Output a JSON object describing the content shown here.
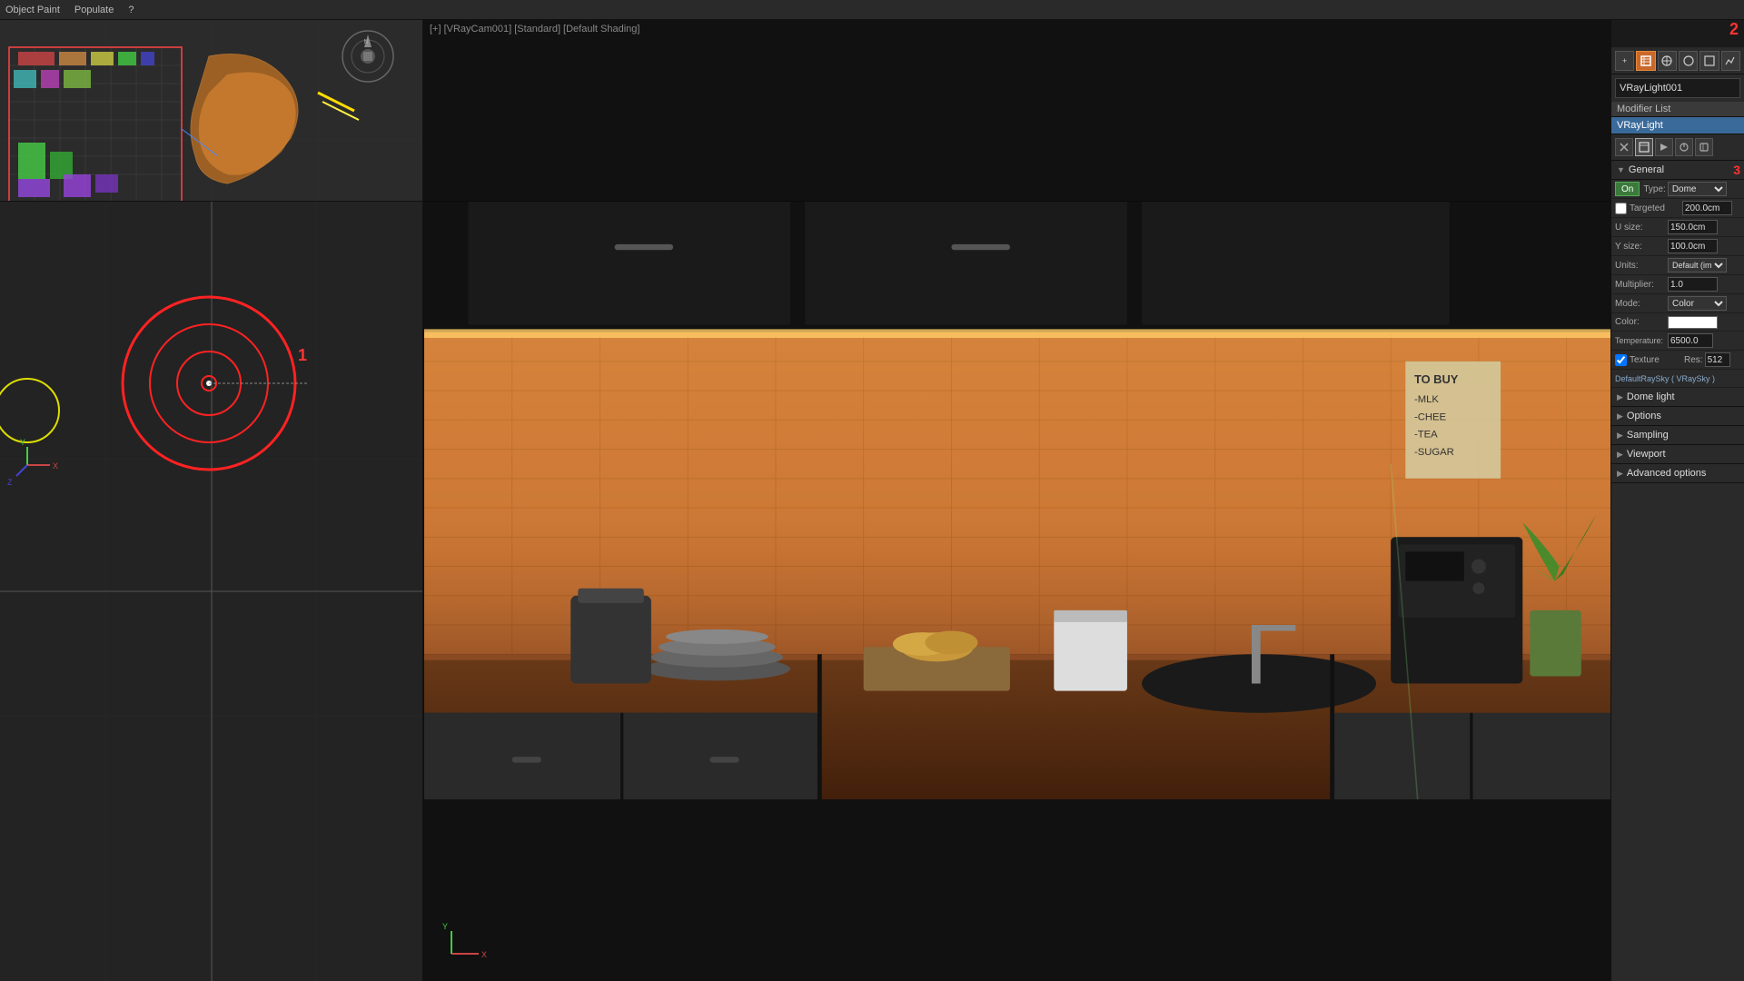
{
  "topbar": {
    "items": [
      "Object Paint",
      "Populate",
      "?"
    ]
  },
  "viewport_top_center": {
    "label": "[+] [VRayCam001] [Standard] [Default Shading]"
  },
  "right_panel": {
    "light_name": "VRayLight001",
    "modifier_list_label": "Modifier List",
    "modifier_active": "VRayLight",
    "badges": {
      "badge2": "2",
      "badge3": "3",
      "badge1": "1"
    },
    "on_button": "On",
    "type_label": "Type:",
    "type_value": "Dome",
    "targeted_label": "Targeted",
    "targeted_value": "200.0cm",
    "u_size_label": "U size:",
    "u_size_value": "150.0cm",
    "y_size_label": "Y size:",
    "y_size_value": "100.0cm",
    "units_label": "Units:",
    "units_value": "Default (image)",
    "multiplier_label": "Multiplier:",
    "multiplier_value": "1.0",
    "mode_label": "Mode:",
    "mode_value": "Color",
    "color_label": "Color:",
    "temperature_label": "Temperature:",
    "temperature_value": "6500.0",
    "texture_label": "Texture",
    "texture_res_label": "Res:",
    "texture_res_value": "512",
    "texture_name": "DefaultRaySky ( VRaySky )",
    "sections": {
      "general": "General",
      "dome_light": "Dome light",
      "options": "Options",
      "sampling": "Sampling",
      "viewport": "Viewport",
      "advanced_options": "Advanced options"
    },
    "subtoolbar_buttons": [
      "pin",
      "panel",
      "render",
      "circle",
      "square"
    ],
    "toolbar_buttons": [
      "+",
      "edit",
      "track",
      "render",
      "sphere",
      "square",
      "graph"
    ]
  },
  "post_it": {
    "lines": [
      "TO BUY",
      "-MLK",
      "-CHEE",
      "-TEA",
      "-SUGAR"
    ]
  }
}
